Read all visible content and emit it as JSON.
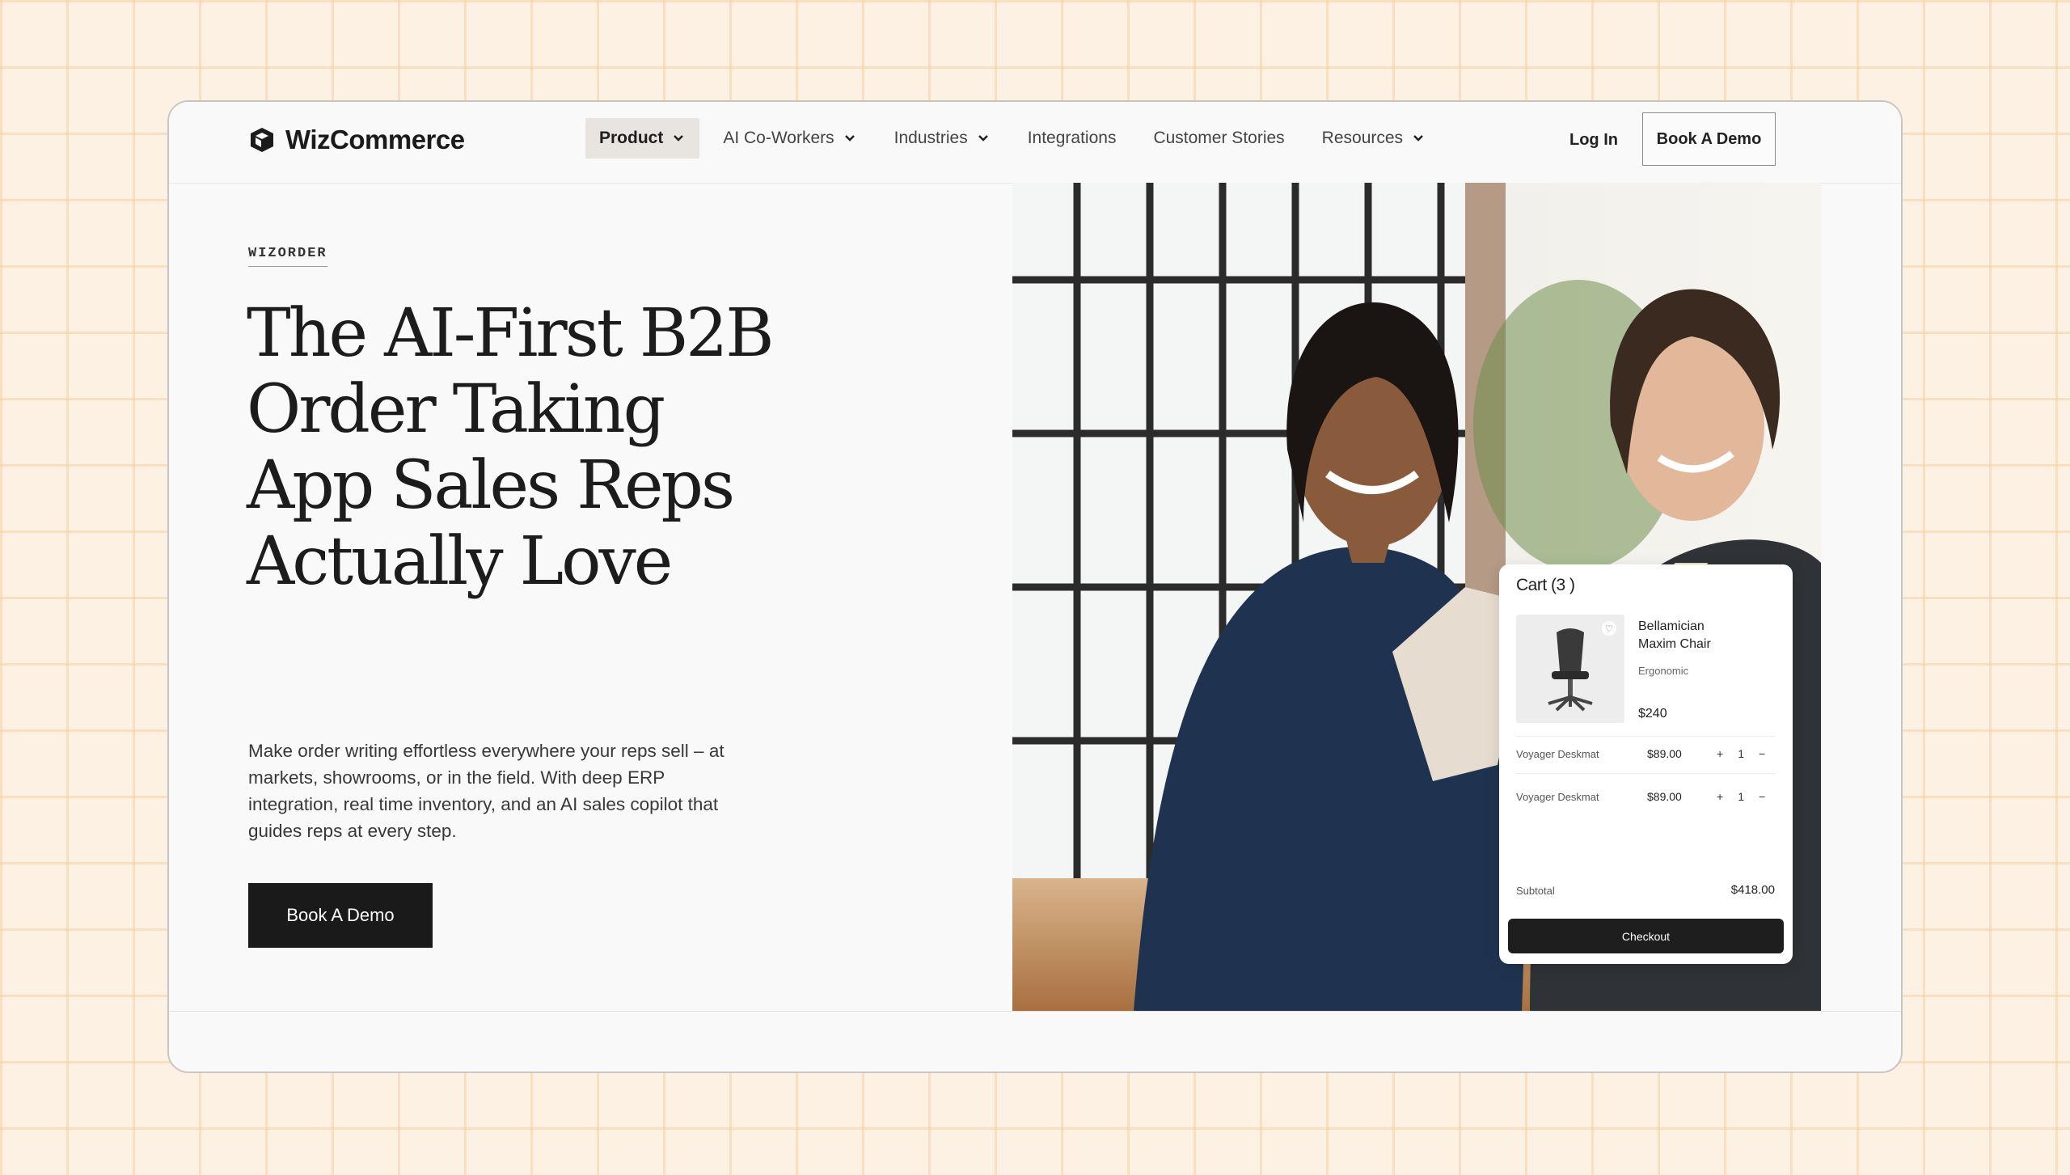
{
  "nav": {
    "brand": "WizCommerce",
    "items": [
      {
        "label": "Product",
        "has_dropdown": true,
        "active": true
      },
      {
        "label": "AI Co-Workers",
        "has_dropdown": true
      },
      {
        "label": "Industries",
        "has_dropdown": true
      },
      {
        "label": "Integrations",
        "has_dropdown": false
      },
      {
        "label": "Customer Stories",
        "has_dropdown": false
      },
      {
        "label": "Resources",
        "has_dropdown": true
      }
    ],
    "login": "Log In",
    "cta": "Book A Demo"
  },
  "hero": {
    "eyebrow": "WIZORDER",
    "headline_lines": [
      "The AI-First B2B",
      "Order Taking",
      "App Sales Reps",
      "Actually Love"
    ],
    "description": "Make order writing effortless everywhere your reps sell – at markets, showrooms, or in the field. With deep ERP integration, real time inventory, and an AI sales copilot that guides reps at every step.",
    "cta": "Book A Demo"
  },
  "cart": {
    "title": "Cart (3 )",
    "product": {
      "name": "Bellamician Maxim Chair",
      "tag": "Ergonomic",
      "price": "$240"
    },
    "line_items": [
      {
        "name": "Voyager Deskmat",
        "price": "$89.00",
        "plus": "+",
        "qty": "1",
        "minus": "−"
      },
      {
        "name": "Voyager Deskmat",
        "price": "$89.00",
        "plus": "+",
        "qty": "1",
        "minus": "−"
      }
    ],
    "subtotal_label": "Subtotal",
    "subtotal_value": "$418.00",
    "checkout": "Checkout"
  },
  "icons": {
    "logo": "cube-logo-icon",
    "dropdown": "chevron-down-icon",
    "wishlist": "heart-icon",
    "product": "office-chair-icon"
  },
  "colors": {
    "background": "#fdf1e3",
    "grid": "#f7cea4",
    "dark": "#1a1a1a",
    "active_tab": "#e8e5e1"
  }
}
